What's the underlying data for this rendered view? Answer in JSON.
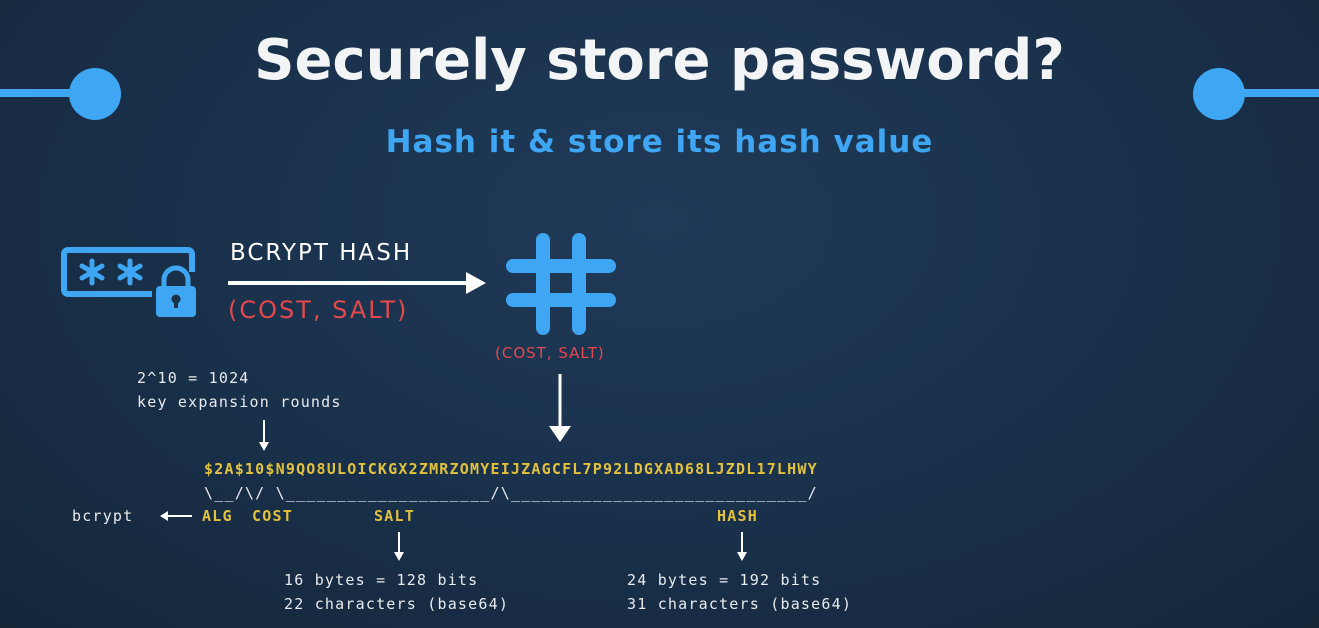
{
  "title": "Securely store password?",
  "subtitle": "Hash it & store its hash value",
  "flow": {
    "arrow_label": "BCRYPT HASH",
    "params_label": "(COST, SALT)",
    "hash_params_label": "(COST, SALT)"
  },
  "icons": {
    "password": "password-field-with-lock-icon",
    "hash": "hash-symbol-icon"
  },
  "cost_note": {
    "line1": "2^10 = 1024",
    "line2": "key expansion rounds"
  },
  "hash_string": "$2A$10$N9QO8ULOICKGX2ZMRZOMYEIJZAGCFL7P92LDGXAD68LJZDL17LHWY",
  "brace_line": "\\__/\\/ \\____________________/\\_____________________________/",
  "parts": {
    "alg_label": "ALG",
    "cost_label": "COST",
    "salt_label": "SALT",
    "hash_label": "HASH",
    "bcrypt_label": "bcrypt"
  },
  "salt_info": {
    "line1": "16 bytes = 128 bits",
    "line2": "22 characters (base64)"
  },
  "hash_info": {
    "line1": "24 bytes = 192 bits",
    "line2": "31 characters (base64)"
  },
  "colors": {
    "background": "#19304a",
    "accent_blue": "#3ea6f2",
    "accent_red": "#e5484d",
    "accent_yellow": "#e2c23c",
    "text_white": "#f2f4f6"
  }
}
